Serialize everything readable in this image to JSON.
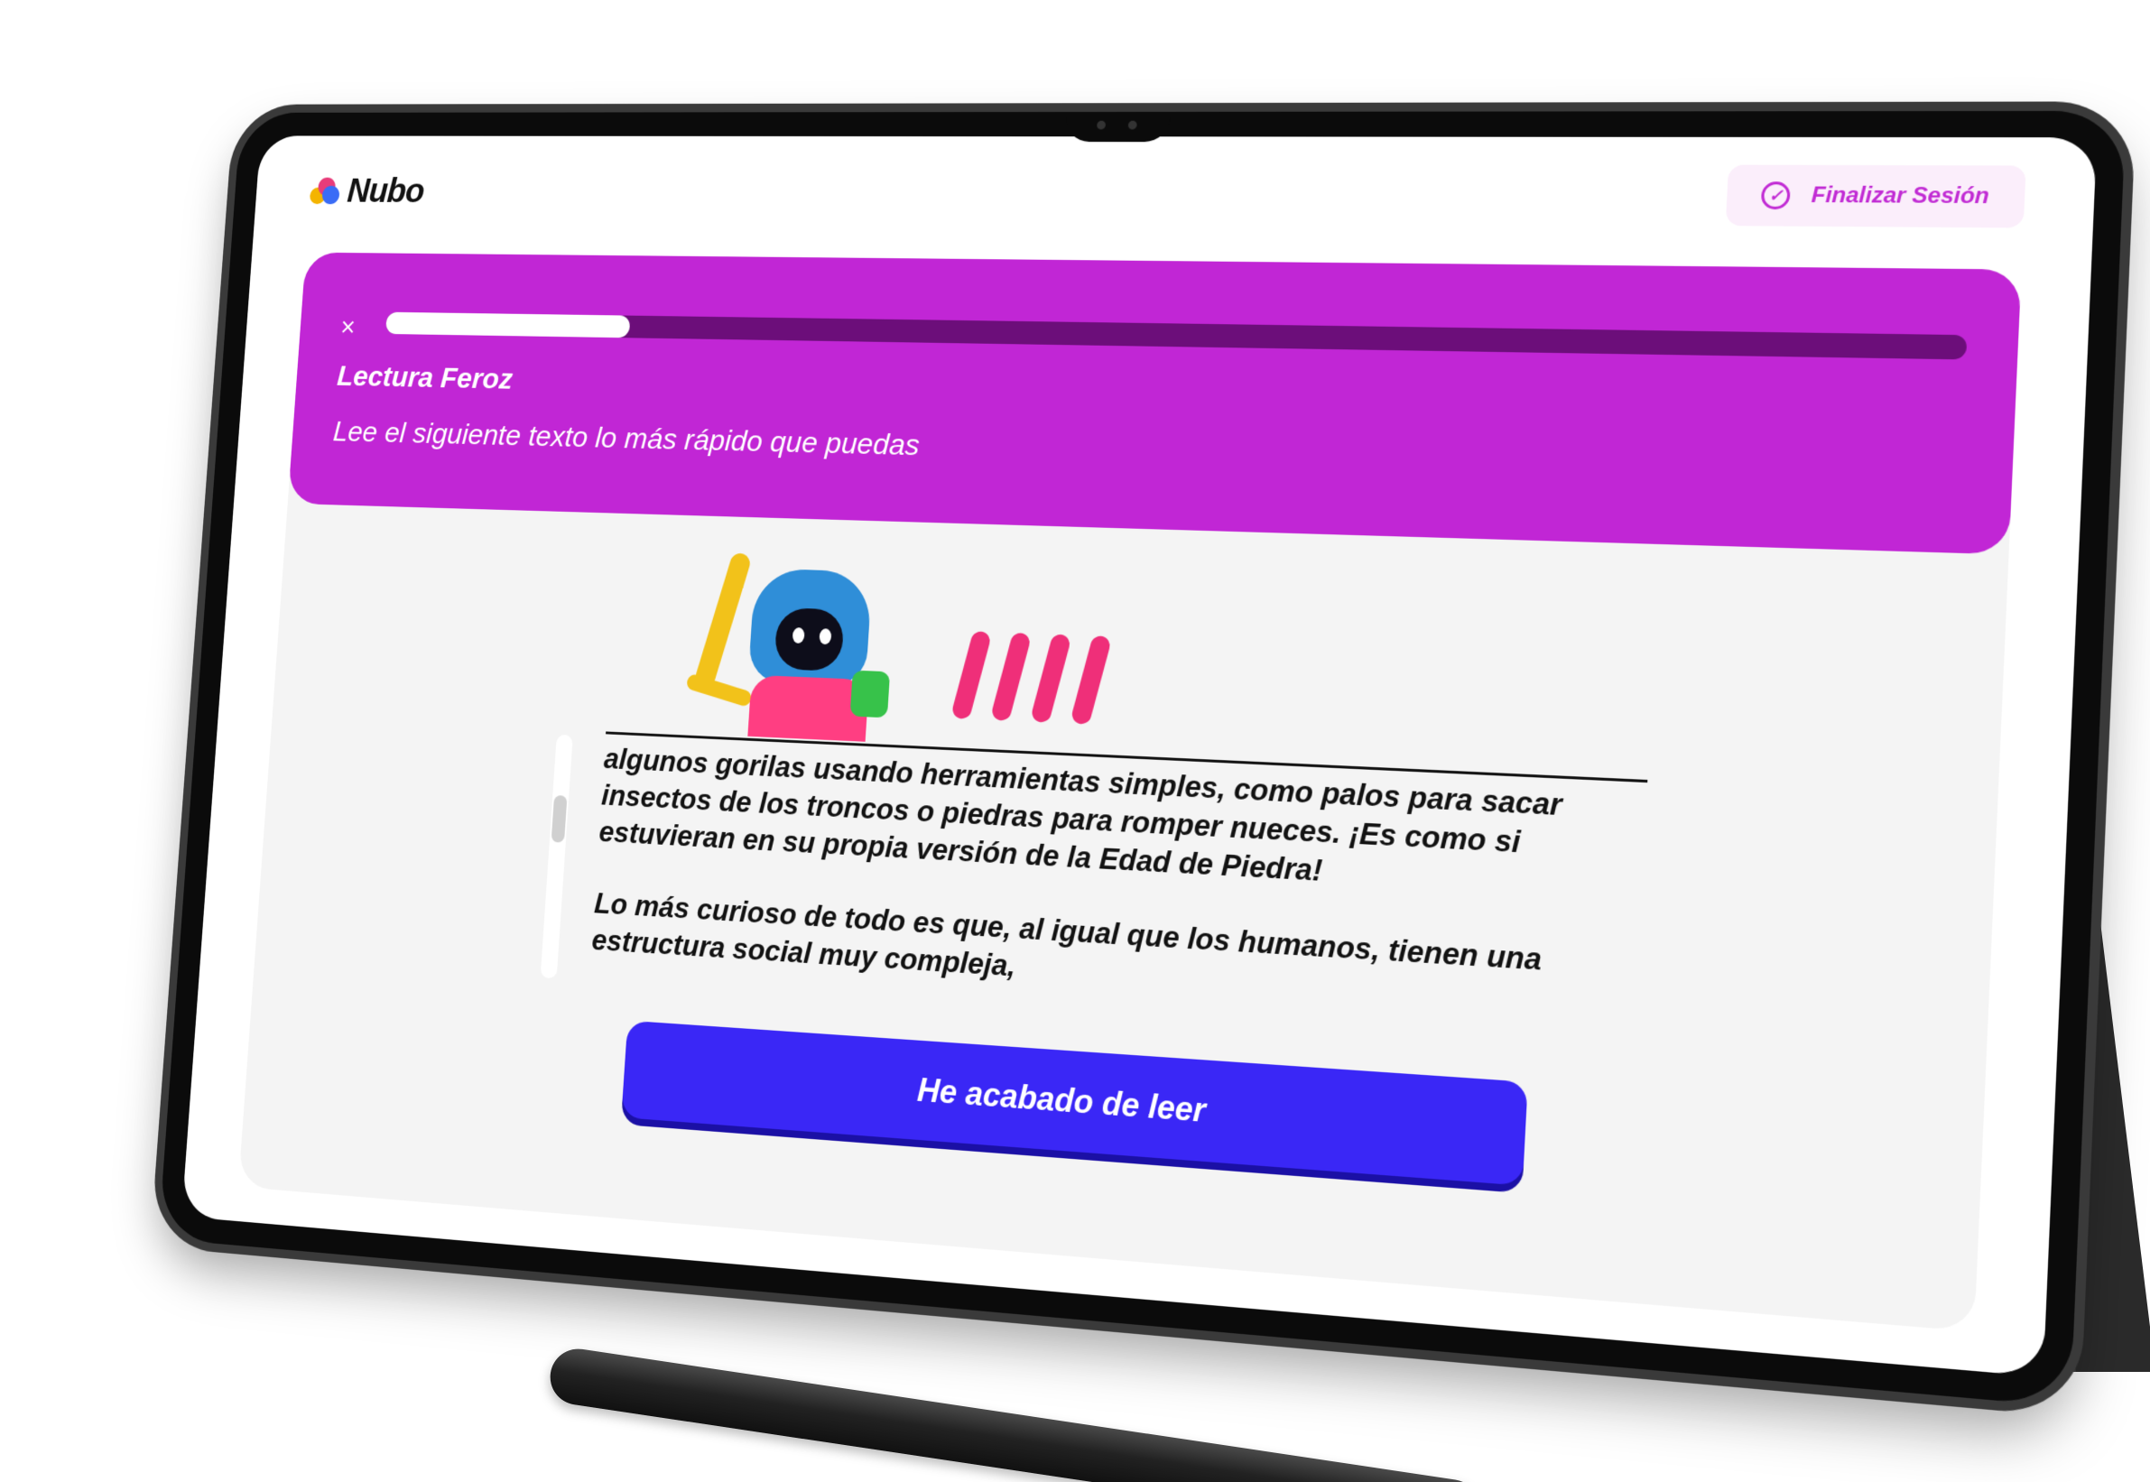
{
  "brand": {
    "name": "Nubo"
  },
  "header": {
    "finish_session_label": "Finalizar Sesión"
  },
  "activity": {
    "close_symbol": "×",
    "progress_fraction": 0.17,
    "title": "Lectura Feroz",
    "subtitle": "Lee el siguiente texto lo más rápido que puedas"
  },
  "reading": {
    "paragraphs": [
      "algunos gorilas usando herramientas simples, como palos para sacar insectos de los troncos o piedras para romper nueces. ¡Es como si estuvieran en su propia versión de la Edad de Piedra!",
      "Lo más curioso de todo es que, al igual que los humanos, tienen una estructura social muy compleja,"
    ]
  },
  "cta": {
    "done_reading_label": "He acabado de leer"
  },
  "colors": {
    "banner": "#c126d5",
    "progress_track": "#6c0e7a",
    "cta": "#3a27f6",
    "accent_pink": "#c12bd4",
    "tally": "#ef2f79"
  },
  "icons": {
    "finish": "check-circle-icon",
    "close": "close-icon",
    "illustration": "knight-mascot-icon",
    "tally": "tally-marks-icon"
  }
}
